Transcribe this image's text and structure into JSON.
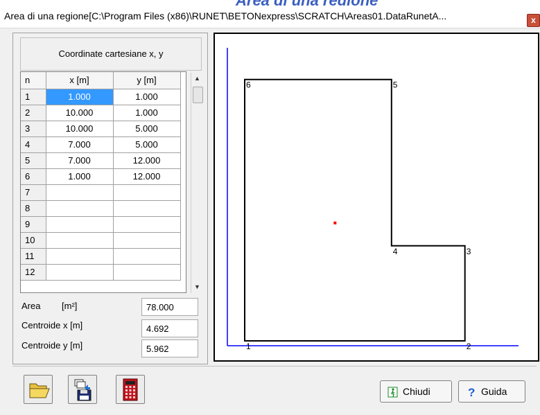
{
  "background_title": "Area di una regione",
  "window": {
    "title": "Area di una regione[C:\\Program Files (x86)\\RUNET\\BETONexpress\\SCRATCH\\Areas01.DataRunetA...",
    "close_glyph": "x"
  },
  "coords": {
    "header": "Coordinate cartesiane x, y",
    "col_n": "n",
    "col_x": "x [m]",
    "col_y": "y [m]",
    "rows": [
      {
        "n": "1",
        "x": "1.000",
        "y": "1.000"
      },
      {
        "n": "2",
        "x": "10.000",
        "y": "1.000"
      },
      {
        "n": "3",
        "x": "10.000",
        "y": "5.000"
      },
      {
        "n": "4",
        "x": "7.000",
        "y": "5.000"
      },
      {
        "n": "5",
        "x": "7.000",
        "y": "12.000"
      },
      {
        "n": "6",
        "x": "1.000",
        "y": "12.000"
      },
      {
        "n": "7",
        "x": "",
        "y": ""
      },
      {
        "n": "8",
        "x": "",
        "y": ""
      },
      {
        "n": "9",
        "x": "",
        "y": ""
      },
      {
        "n": "10",
        "x": "",
        "y": ""
      },
      {
        "n": "11",
        "x": "",
        "y": ""
      },
      {
        "n": "12",
        "x": "",
        "y": ""
      }
    ]
  },
  "results": {
    "area_label": "Area",
    "area_unit": "[m²]",
    "area_value": "78.000",
    "cx_label": "Centroide x [m]",
    "cx_value": "4.692",
    "cy_label": "Centroide y [m]",
    "cy_value": "5.962"
  },
  "plot": {
    "polygon_points": [
      [
        1,
        1
      ],
      [
        10,
        1
      ],
      [
        10,
        5
      ],
      [
        7,
        5
      ],
      [
        7,
        12
      ],
      [
        1,
        12
      ]
    ],
    "vertex_labels": [
      "1",
      "2",
      "3",
      "4",
      "5",
      "6"
    ],
    "centroid": [
      4.692,
      5.962
    ],
    "axis_color": "#0000ff",
    "centroid_color": "#ff0000"
  },
  "buttons": {
    "open_icon": "folder-open-icon",
    "save_icon": "save-disk-icon",
    "calc_icon": "calculator-icon",
    "close_label": "Chiudi",
    "help_label": "Guida"
  }
}
